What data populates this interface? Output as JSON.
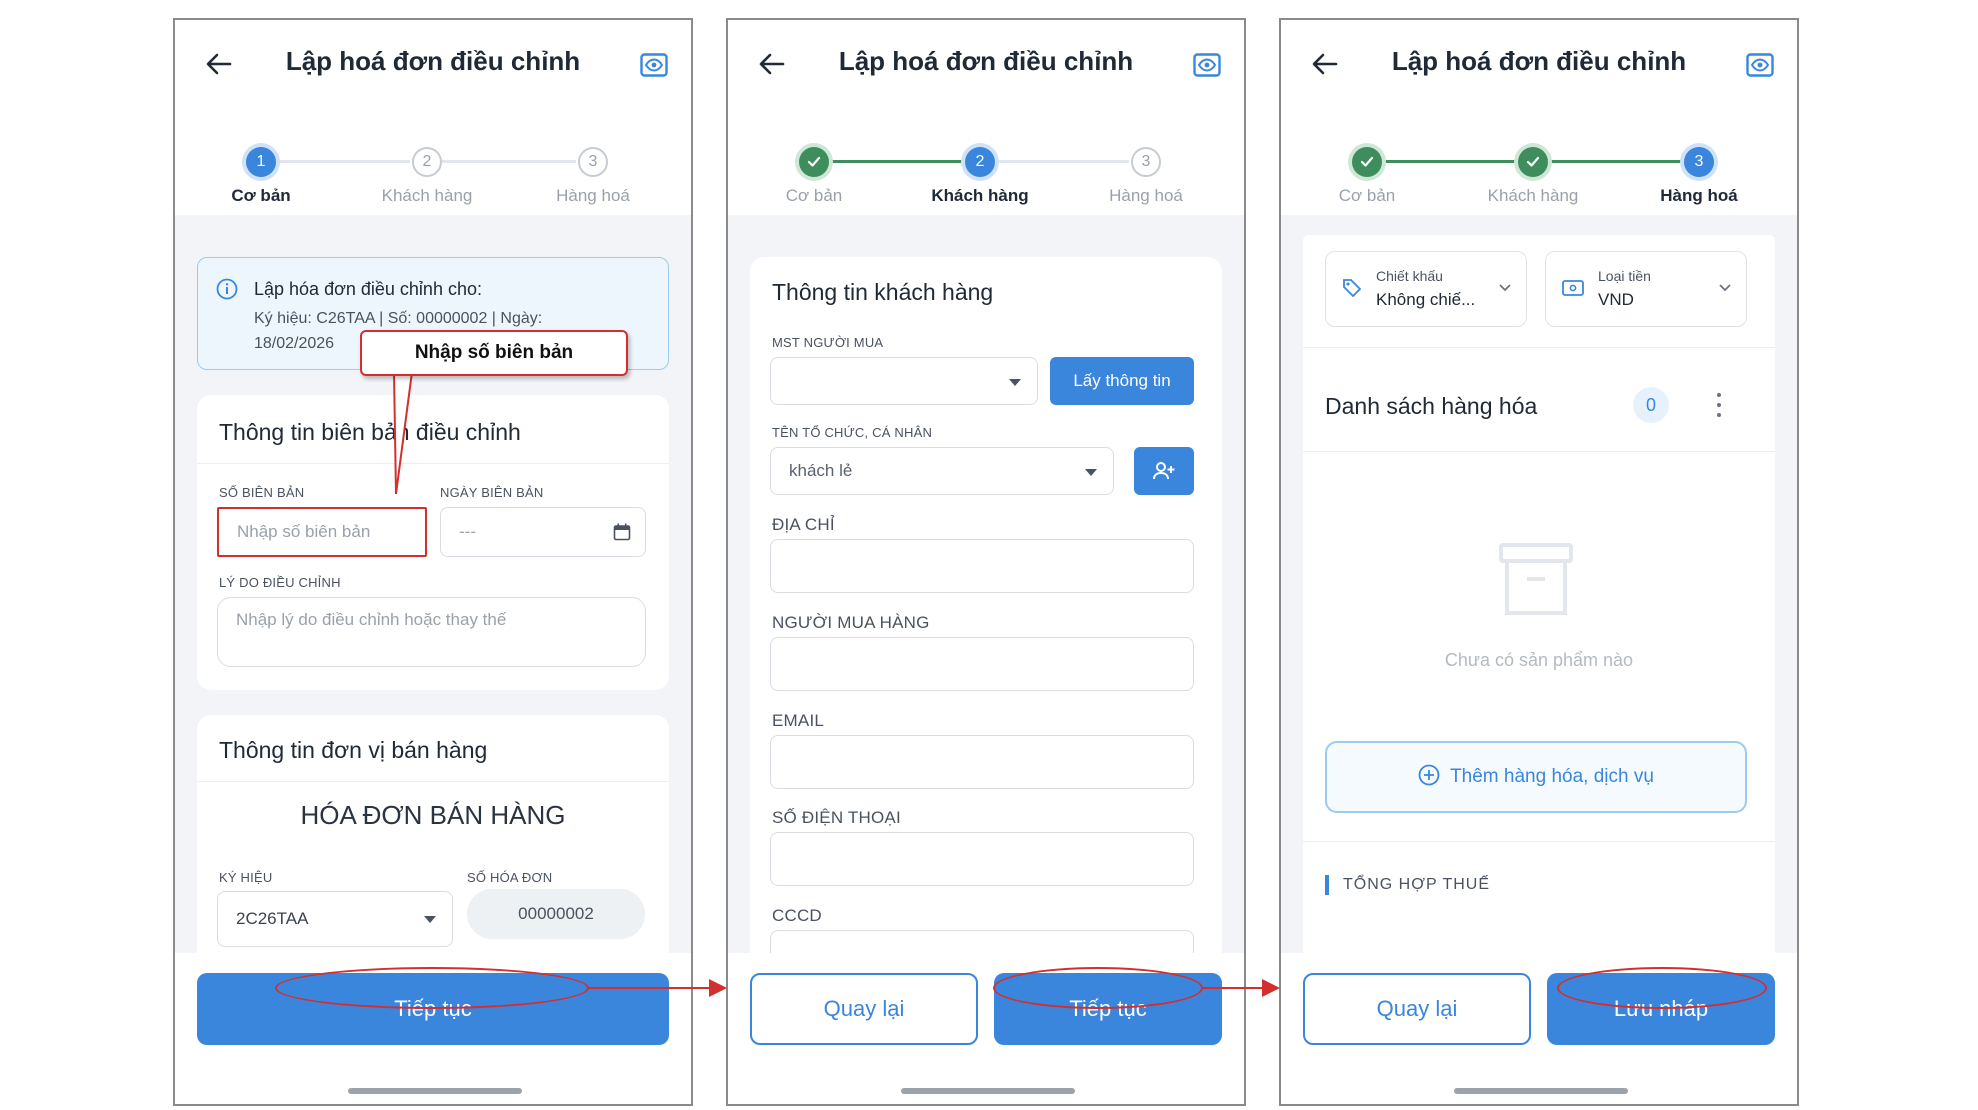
{
  "screens": [
    {
      "title": "Lập hoá đơn điều chỉnh",
      "steps": [
        "Cơ bản",
        "Khách hàng",
        "Hàng hoá"
      ],
      "step_numbers": [
        "1",
        "2",
        "3"
      ],
      "info_box": {
        "title": "Lập hóa đơn điều chỉnh cho:",
        "detail_line1": "Ký hiệu: C26TAA | Số: 00000002 | Ngày:",
        "detail_line2": "18/02/2026"
      },
      "record_section": {
        "title": "Thông tin biên bản điều chỉnh",
        "so_bien_ban_label": "SỐ BIÊN BẢN",
        "so_bien_ban_placeholder": "Nhập số biên bản",
        "ngay_bien_ban_label": "NGÀY BIÊN BẢN",
        "ngay_bien_ban_placeholder": "---",
        "ly_do_label": "LÝ DO ĐIỀU CHỈNH",
        "ly_do_placeholder": "Nhập lý do điều chỉnh hoặc thay thế"
      },
      "seller_section": {
        "title": "Thông tin đơn vị bán hàng",
        "invoice_type": "HÓA ĐƠN BÁN HÀNG",
        "ky_hieu_label": "KÝ HIỆU",
        "ky_hieu_value": "2C26TAA",
        "so_hoa_don_label": "SỐ HÓA ĐƠN",
        "so_hoa_don_value": "00000002"
      },
      "continue_button": "Tiếp tục",
      "callout": "Nhập số biên bản"
    },
    {
      "title": "Lập hoá đơn điều chỉnh",
      "steps": [
        "Cơ bản",
        "Khách hàng",
        "Hàng hoá"
      ],
      "step_numbers": [
        "",
        "2",
        "3"
      ],
      "section_title": "Thông tin khách hàng",
      "mst_label": "MST NGƯỜI MUA",
      "lookup_button": "Lấy thông tin",
      "org_label": "TÊN TỔ CHỨC, CÁ NHÂN",
      "org_value": "khách lẻ",
      "address_label": "ĐỊA CHỈ",
      "buyer_label": "NGƯỜI MUA HÀNG",
      "email_label": "EMAIL",
      "phone_label": "SỐ ĐIỆN THOẠI",
      "cccd_label": "CCCD",
      "back_button": "Quay lại",
      "continue_button": "Tiếp tục"
    },
    {
      "title": "Lập hoá đơn điều chỉnh",
      "steps": [
        "Cơ bản",
        "Khách hàng",
        "Hàng hoá"
      ],
      "step_numbers": [
        "",
        "",
        "3"
      ],
      "discount_label": "Chiết khấu",
      "discount_value": "Không chiế...",
      "currency_label": "Loại tiền",
      "currency_value": "VND",
      "goods_title": "Danh sách hàng hóa",
      "goods_count": "0",
      "empty_text": "Chưa có sản phẩm nào",
      "add_button": "Thêm hàng hóa, dịch vụ",
      "tax_summary": "TỔNG HỢP THUẾ",
      "back_button": "Quay lại",
      "save_button": "Lưu nháp"
    }
  ],
  "colors": {
    "primary": "#3a86dd",
    "done": "#3e8d5c",
    "annotation": "#d32f2f",
    "info_bg": "#eef6fd"
  }
}
